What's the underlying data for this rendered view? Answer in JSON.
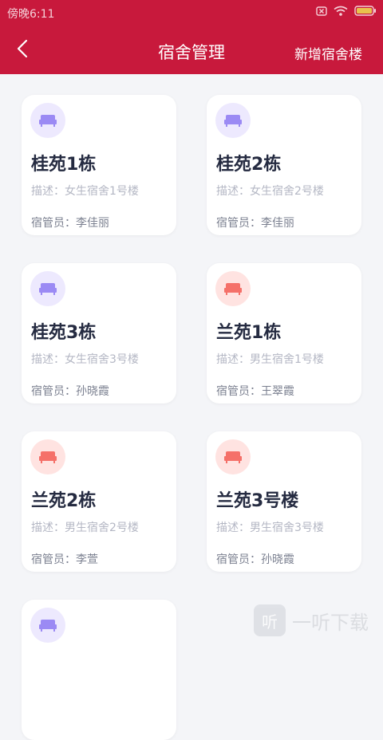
{
  "status_bar": {
    "time": "傍晚6:11"
  },
  "header": {
    "title": "宿舍管理",
    "action_label": "新增宿舍楼"
  },
  "colors": {
    "header_bg": "#c8193c",
    "purple_icon": "#9b8af4",
    "red_icon": "#f57069"
  },
  "buildings": [
    {
      "name": "桂苑1栋",
      "description": "描述：女生宿舍1号楼",
      "manager": "宿管员：李佳丽",
      "icon": "bed-icon",
      "theme": "purple"
    },
    {
      "name": "桂苑2栋",
      "description": "描述：女生宿舍2号楼",
      "manager": "宿管员：李佳丽",
      "icon": "bed-icon",
      "theme": "purple"
    },
    {
      "name": "桂苑3栋",
      "description": "描述：女生宿舍3号楼",
      "manager": "宿管员：孙晓霞",
      "icon": "bed-icon",
      "theme": "purple"
    },
    {
      "name": "兰苑1栋",
      "description": "描述：男生宿舍1号楼",
      "manager": "宿管员：王翠霞",
      "icon": "bed-icon",
      "theme": "red"
    },
    {
      "name": "兰苑2栋",
      "description": "描述：男生宿舍2号楼",
      "manager": "宿管员：李萱",
      "icon": "bed-icon",
      "theme": "red"
    },
    {
      "name": "兰苑3号楼",
      "description": "描述：男生宿舍3号楼",
      "manager": "宿管员：孙晓霞",
      "icon": "bed-icon",
      "theme": "red"
    },
    {
      "name": "",
      "description": "",
      "manager": "",
      "icon": "bed-icon",
      "theme": "purple"
    }
  ],
  "watermark": {
    "text": "一听下载",
    "logo_glyph": "听"
  }
}
